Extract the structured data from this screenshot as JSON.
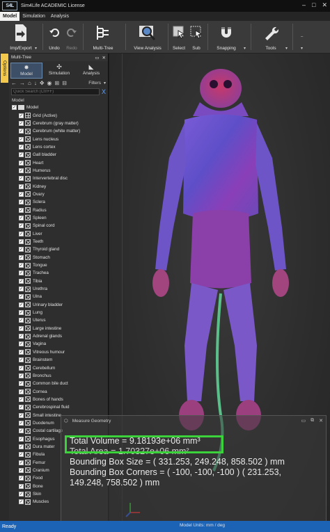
{
  "app": {
    "logo": "S4L",
    "title": "Sim4Life ACADEMIC License"
  },
  "window_controls": [
    "–",
    "□",
    "✕"
  ],
  "menu": [
    "Model",
    "Simulation",
    "Analysis"
  ],
  "toolbar": {
    "imp_export": "Imp/Export",
    "undo": "Undo",
    "redo": "Redo",
    "multi_tree": "Multi-Tree",
    "view_analysis": "View Analysis",
    "select": "Select",
    "sub": "Sub",
    "snapping": "Snapping",
    "tools": "Tools"
  },
  "options_tab": "Options",
  "panel": {
    "title": "Multi-Tree",
    "tabs": [
      "Model",
      "Simulation",
      "Analysis"
    ],
    "filters": "Filters",
    "search_placeholder": "Quick Search (Ctrl+F)",
    "section": "Model",
    "root": "Model",
    "items": [
      "Grid (Active)",
      "Cerebrum (gray matter)",
      "Cerebrum (white matter)",
      "Lens nucleus",
      "Lens cortex",
      "Gall bladder",
      "Heart",
      "Humerus",
      "Intervertebral disc",
      "Kidney",
      "Ovary",
      "Sclera",
      "Radius",
      "Spleen",
      "Spinal cord",
      "Liver",
      "Teeth",
      "Thyroid gland",
      "Stomach",
      "Tongue",
      "Trachea",
      "Tibia",
      "Urethra",
      "Ulna",
      "Urinary bladder",
      "Lung",
      "Uterus",
      "Large intestine",
      "Adrenal glands",
      "Vagina",
      "Vitreous humour",
      "Brainstem",
      "Cerebellum",
      "Bronchus",
      "Common bile duct",
      "Cornea",
      "Bones of hands",
      "Cerebrospinal fluid",
      "Small intestine",
      "Duodenum",
      "Costal cartilage",
      "Esophagus",
      "Dura mater",
      "Fibula",
      "Femur",
      "Cranium",
      "Food",
      "Bone",
      "Skin",
      "Muscles"
    ]
  },
  "measure": {
    "title": "Measure Geometry",
    "total_volume": "Total Volume = 9.18193e+06 mm³",
    "total_area": "Total Area = 1.70327e+06 mm²",
    "bbox_size": "Bounding Box Size = ( 331.253, 249.248, 858.502 ) mm",
    "bbox_corners_1": "Bounding Box Corners = ( -100, -100, -100 ) ( 231.253,",
    "bbox_corners_2": "149.248, 758.502 ) mm"
  },
  "status": {
    "text": "Ready",
    "units": "Model Units: mm / deg"
  },
  "colors": {
    "accent": "#1d63b5",
    "highlight": "#3bd23b",
    "options_tab": "#f2c94c"
  }
}
